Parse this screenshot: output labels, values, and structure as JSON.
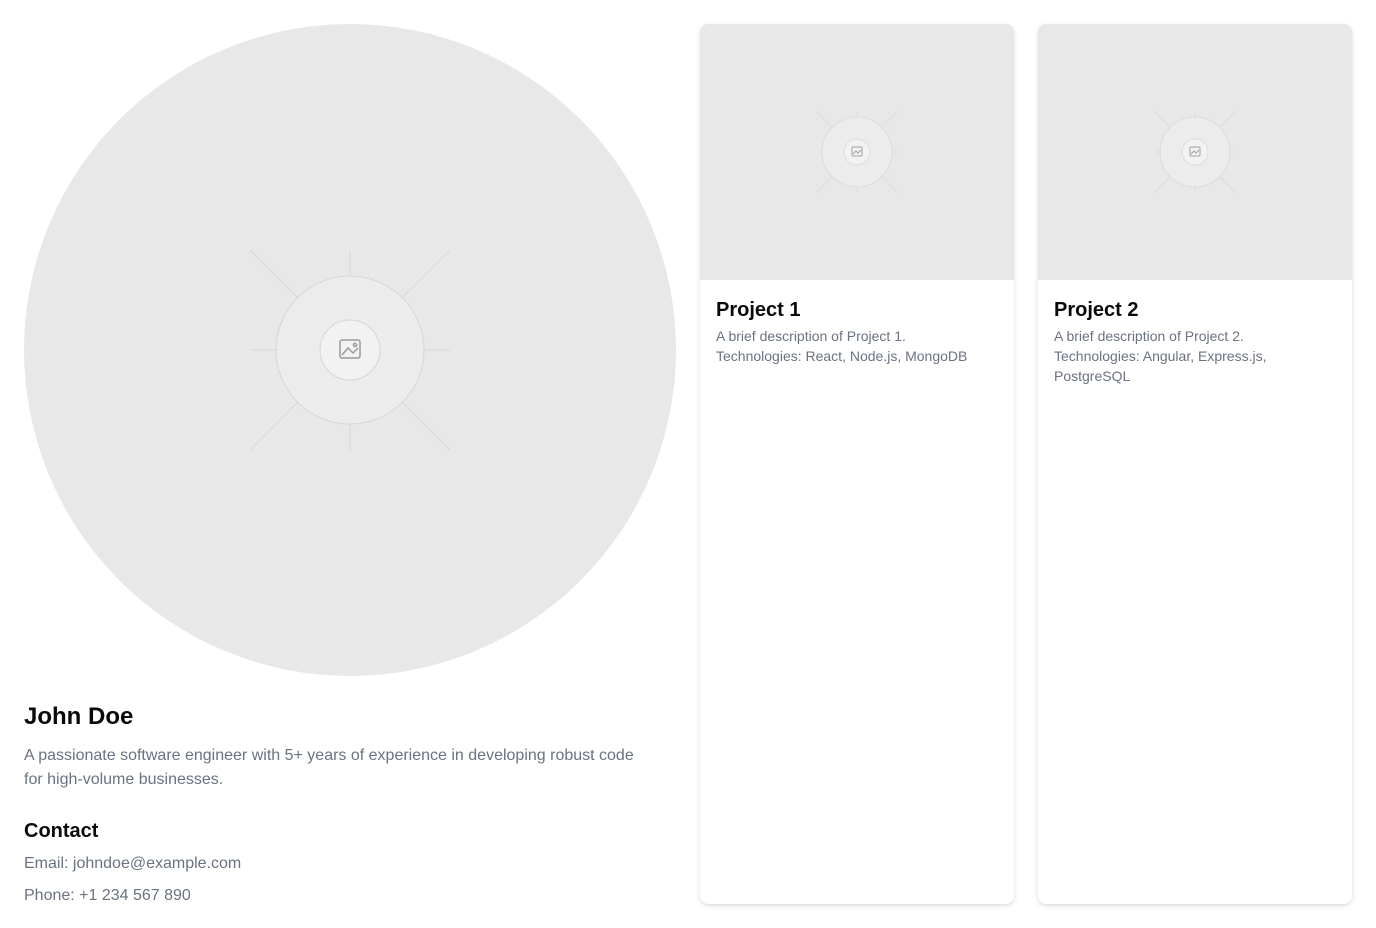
{
  "profile": {
    "avatar_icon": "image-placeholder-icon",
    "name": "John Doe",
    "bio": "A passionate software engineer with 5+ years of experience in developing robust code for high-volume businesses.",
    "contact": {
      "heading": "Contact",
      "email": "Email: johndoe@example.com",
      "phone": "Phone: +1 234 567 890"
    }
  },
  "projects": [
    {
      "image_icon": "image-placeholder-icon",
      "title": "Project 1",
      "description": "A brief description of Project 1.",
      "technologies": "Technologies: React, Node.js, MongoDB"
    },
    {
      "image_icon": "image-placeholder-icon",
      "title": "Project 2",
      "description": "A brief description of Project 2.",
      "technologies": "Technologies: Angular, Express.js, PostgreSQL"
    }
  ],
  "colors": {
    "placeholder_bg": "#e8e8e8",
    "muted_text": "#6b7280",
    "heading_text": "#0a0a0a"
  }
}
